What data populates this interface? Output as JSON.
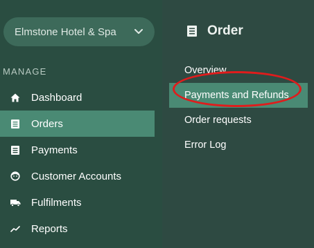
{
  "venue_selector": {
    "label": "Elmstone Hotel & Spa",
    "icon": "chevron-down-icon"
  },
  "sidebar": {
    "section_heading": "MANAGE",
    "items": [
      {
        "label": "Dashboard",
        "icon": "home-icon"
      },
      {
        "label": "Orders",
        "icon": "list-icon",
        "active": true
      },
      {
        "label": "Payments",
        "icon": "list-icon"
      },
      {
        "label": "Customer Accounts",
        "icon": "face-icon"
      },
      {
        "label": "Fulfilments",
        "icon": "truck-icon"
      },
      {
        "label": "Reports",
        "icon": "trend-icon"
      }
    ]
  },
  "panel": {
    "title": "Order",
    "title_icon": "list-icon",
    "items": [
      {
        "label": "Overview"
      },
      {
        "label": "Payments and Refunds",
        "active": true
      },
      {
        "label": "Order requests"
      },
      {
        "label": "Error Log"
      }
    ]
  },
  "colors": {
    "sidebar_bg": "#2a4d41",
    "panel_bg": "#2e4a42",
    "active_bg": "#4a8a74",
    "highlight_ring": "#e01c1c"
  }
}
